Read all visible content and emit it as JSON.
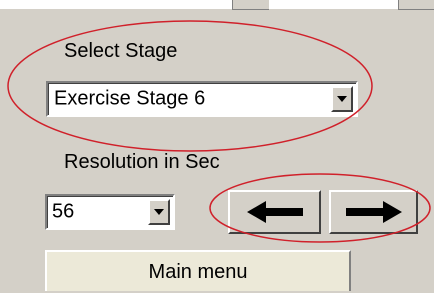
{
  "stage": {
    "label": "Select Stage",
    "selected": "Exercise Stage 6"
  },
  "resolution": {
    "label": "Resolution in Sec",
    "selected": "56"
  },
  "navigation": {
    "prev_icon": "arrow-left-icon",
    "next_icon": "arrow-right-icon"
  },
  "main_menu": {
    "label": "Main menu"
  },
  "colors": {
    "panel": "#d4d0c8",
    "annotation_ellipse": "#d0202a"
  }
}
